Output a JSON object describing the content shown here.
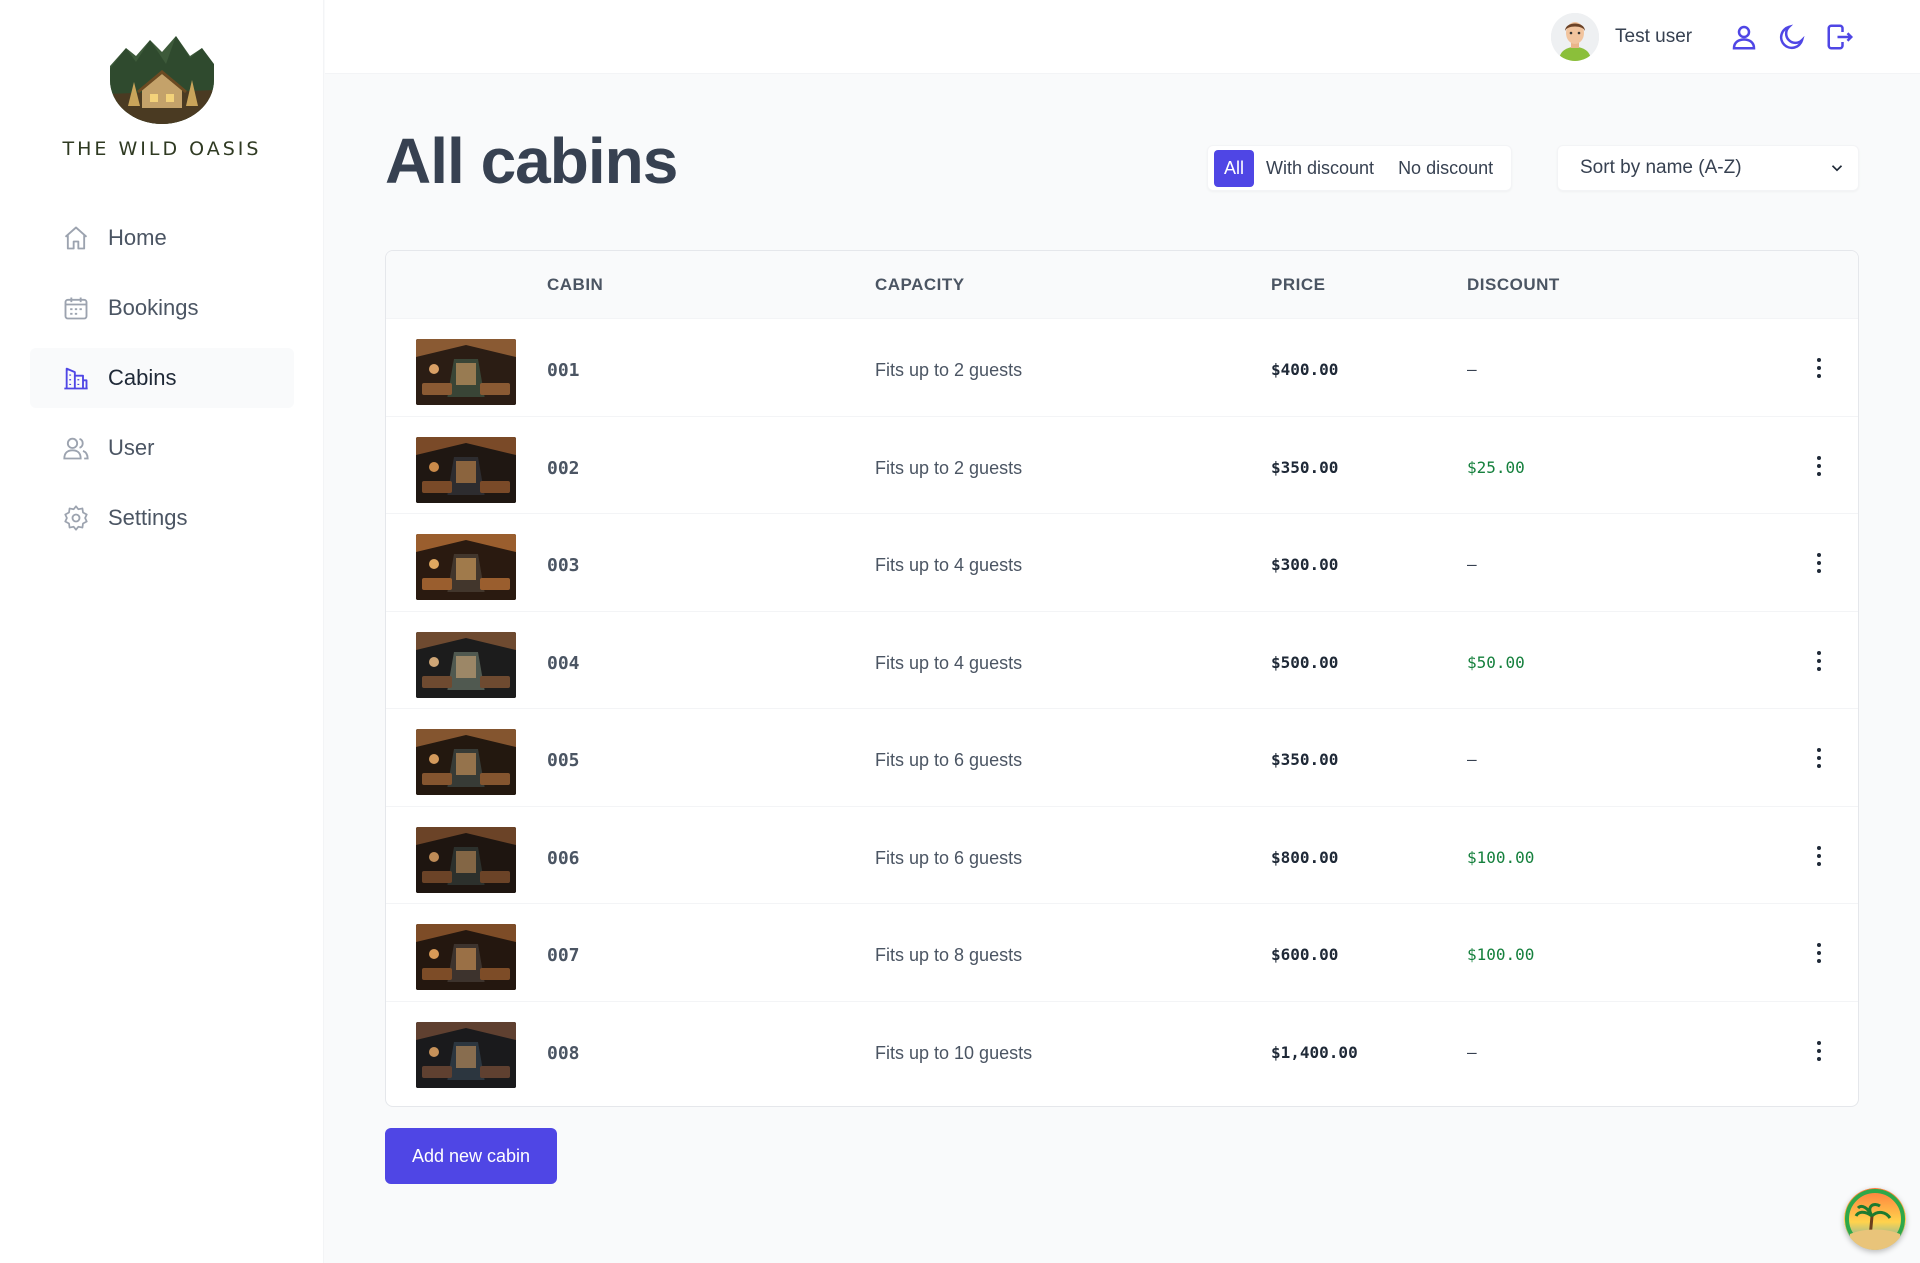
{
  "brand": {
    "name": "THE WILD OASIS"
  },
  "nav": [
    {
      "label": "Home",
      "icon": "home-icon"
    },
    {
      "label": "Bookings",
      "icon": "calendar-icon"
    },
    {
      "label": "Cabins",
      "icon": "buildings-icon",
      "active": true
    },
    {
      "label": "User",
      "icon": "users-icon"
    },
    {
      "label": "Settings",
      "icon": "gear-icon"
    }
  ],
  "header": {
    "user_name": "Test user",
    "actions": [
      "account-icon",
      "dark-mode-icon",
      "logout-icon"
    ]
  },
  "page": {
    "title": "All cabins"
  },
  "filter": {
    "options": [
      "All",
      "With discount",
      "No discount"
    ],
    "selected": "All"
  },
  "sort": {
    "selected": "Sort by name (A-Z)"
  },
  "table": {
    "columns": [
      "",
      "CABIN",
      "CAPACITY",
      "PRICE",
      "DISCOUNT"
    ],
    "rows": [
      {
        "name": "001",
        "capacity": "Fits up to 2 guests",
        "price": "$400.00",
        "discount": "—"
      },
      {
        "name": "002",
        "capacity": "Fits up to 2 guests",
        "price": "$350.00",
        "discount": "$25.00"
      },
      {
        "name": "003",
        "capacity": "Fits up to 4 guests",
        "price": "$300.00",
        "discount": "—"
      },
      {
        "name": "004",
        "capacity": "Fits up to 4 guests",
        "price": "$500.00",
        "discount": "$50.00"
      },
      {
        "name": "005",
        "capacity": "Fits up to 6 guests",
        "price": "$350.00",
        "discount": "—"
      },
      {
        "name": "006",
        "capacity": "Fits up to 6 guests",
        "price": "$800.00",
        "discount": "$100.00"
      },
      {
        "name": "007",
        "capacity": "Fits up to 8 guests",
        "price": "$600.00",
        "discount": "$100.00"
      },
      {
        "name": "008",
        "capacity": "Fits up to 10 guests",
        "price": "$1,400.00",
        "discount": "—"
      }
    ]
  },
  "add_button": {
    "label": "Add new cabin"
  },
  "colors": {
    "accent": "#4f46e5",
    "discount": "#15803d"
  }
}
